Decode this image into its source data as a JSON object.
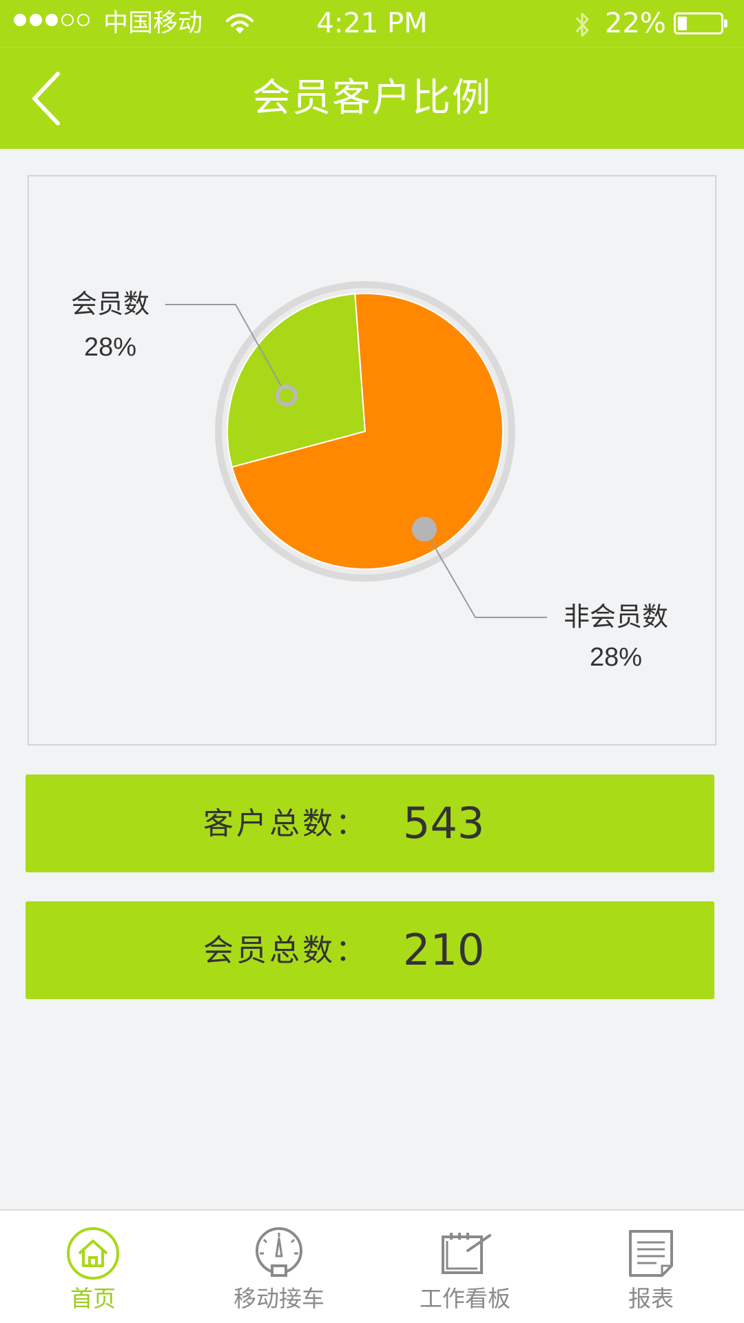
{
  "status_bar": {
    "carrier": "中国移动",
    "time": "4:21 PM",
    "battery_text": "22%",
    "battery_level": 0.22
  },
  "header": {
    "title": "会员客户比例"
  },
  "chart_data": {
    "type": "pie",
    "slices": [
      {
        "label": "会员数",
        "value_text": "28%",
        "value": 28,
        "color": "#a8d817"
      },
      {
        "label": "非会员数",
        "value_text": "28%",
        "value": 72,
        "color": "#ff8800"
      }
    ]
  },
  "stats": {
    "total_customers_label": "客户总数：",
    "total_customers_value": "543",
    "total_members_label": "会员总数：",
    "total_members_value": "210"
  },
  "tab_bar": {
    "items": [
      {
        "label": "首页",
        "icon": "home-icon",
        "active": true
      },
      {
        "label": "移动接车",
        "icon": "speedometer-icon",
        "active": false
      },
      {
        "label": "工作看板",
        "icon": "board-icon",
        "active": false
      },
      {
        "label": "报表",
        "icon": "report-icon",
        "active": false
      }
    ]
  },
  "colors": {
    "brand_green": "#aadb17",
    "member_slice": "#a8d817",
    "non_member_slice": "#ff8800",
    "active_tab": "#9ccc1a",
    "inactive_tab": "#8a8a8a"
  }
}
